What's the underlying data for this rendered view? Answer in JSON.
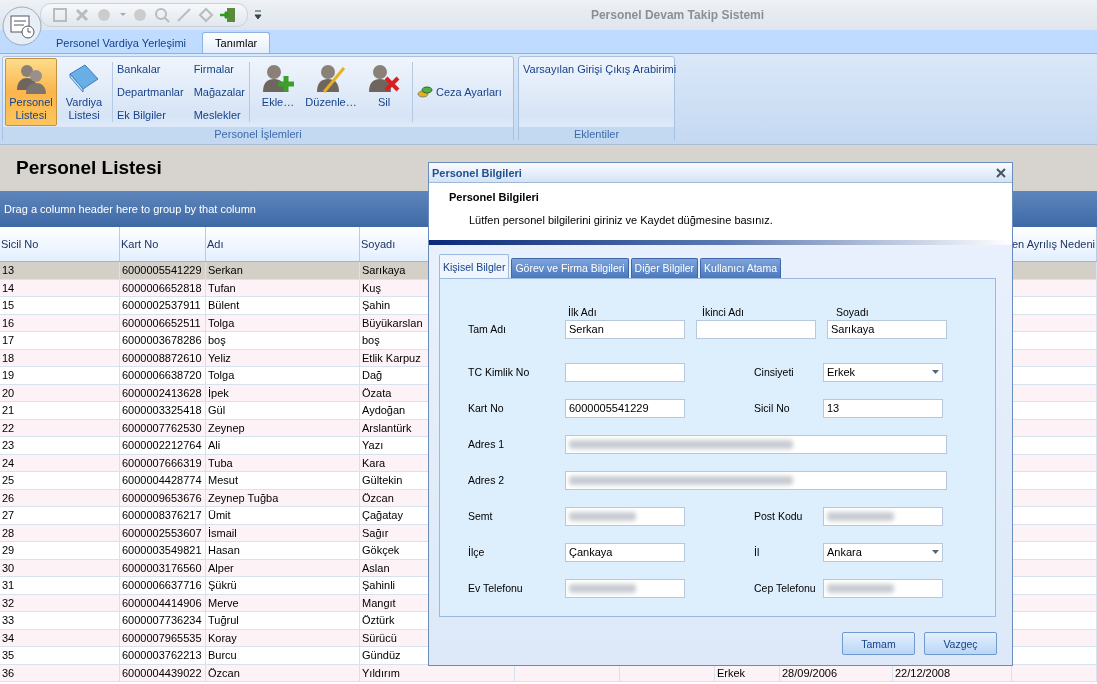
{
  "window": {
    "title": "Personel Devam Takip Sistemi"
  },
  "ribbon_tabs": [
    {
      "label": "Personel Vardiya Yerleşimi",
      "selected": false
    },
    {
      "label": "Tanımlar",
      "selected": true
    }
  ],
  "ribbon_groups": [
    {
      "caption": "Personel İşlemleri",
      "sections": [
        {
          "items": [
            {
              "kind": "large",
              "label": "Personel Listesi",
              "selected": true
            },
            {
              "kind": "large",
              "label": "Vardiya Listesi",
              "selected": false
            }
          ]
        },
        {
          "items": [
            {
              "kind": "link",
              "label": "Bankalar"
            },
            {
              "kind": "link",
              "label": "Departmanlar"
            },
            {
              "kind": "link",
              "label": "Ek Bilgiler"
            },
            {
              "kind": "link",
              "label": "Firmalar"
            },
            {
              "kind": "link",
              "label": "Mağazalar"
            },
            {
              "kind": "link",
              "label": "Meslekler"
            }
          ]
        },
        {
          "items": [
            {
              "kind": "large",
              "label": "Ekle…",
              "selected": false
            },
            {
              "kind": "large",
              "label": "Düzenle…",
              "selected": false
            },
            {
              "kind": "large",
              "label": "Sil",
              "selected": false
            }
          ]
        },
        {
          "items": [
            {
              "kind": "iconlink",
              "label": "Ceza Ayarları"
            }
          ]
        }
      ]
    },
    {
      "caption": "Eklentiler",
      "sections": [
        {
          "items": [
            {
              "kind": "link",
              "label": "Varsayılan Girişi Çıkış Arabirimi"
            }
          ]
        }
      ]
    }
  ],
  "page_title": "Personel Listesi",
  "group_panel": "Drag a column header here to group by that column",
  "table": {
    "columns": [
      "Sicil No",
      "Kart No",
      "Adı",
      "Soyadı"
    ],
    "last_column": "en Ayrılış Nedeni",
    "rows": [
      {
        "cells": [
          "13",
          "6000005541229",
          "Serkan",
          "Sarıkaya"
        ],
        "selected": true
      },
      {
        "cells": [
          "14",
          "6000006652818",
          "Tufan",
          "Kuş"
        ],
        "selected": false
      },
      {
        "cells": [
          "15",
          "6000002537911",
          "Bülent",
          "Şahin"
        ],
        "selected": false
      },
      {
        "cells": [
          "16",
          "6000006652511",
          "Tolga",
          "Büyükarslan"
        ],
        "selected": false
      },
      {
        "cells": [
          "17",
          "6000003678286",
          "boş",
          "boş"
        ],
        "selected": false
      },
      {
        "cells": [
          "18",
          "6000008872610",
          "Yeliz",
          "Etlik Karpuz"
        ],
        "selected": false
      },
      {
        "cells": [
          "19",
          "6000006638720",
          "Tolga",
          "Dağ"
        ],
        "selected": false
      },
      {
        "cells": [
          "20",
          "6000002413628",
          "İpek",
          "Özata"
        ],
        "selected": false
      },
      {
        "cells": [
          "21",
          "6000003325418",
          "Gül",
          "Aydoğan"
        ],
        "selected": false
      },
      {
        "cells": [
          "22",
          "6000007762530",
          "Zeynep",
          "Arslantürk"
        ],
        "selected": false
      },
      {
        "cells": [
          "23",
          "6000002212764",
          "Ali",
          "Yazı"
        ],
        "selected": false
      },
      {
        "cells": [
          "24",
          "6000007666319",
          "Tuba",
          "Kara"
        ],
        "selected": false
      },
      {
        "cells": [
          "25",
          "6000004428774",
          "Mesut",
          "Gültekin"
        ],
        "selected": false
      },
      {
        "cells": [
          "26",
          "6000009653676",
          "Zeynep Tuğba",
          "Özcan"
        ],
        "selected": false
      },
      {
        "cells": [
          "27",
          "6000008376217",
          "Ümit",
          "Çağatay"
        ],
        "selected": false
      },
      {
        "cells": [
          "28",
          "6000002553607",
          "İsmail",
          "Sağır"
        ],
        "selected": false
      },
      {
        "cells": [
          "29",
          "6000003549821",
          "Hasan",
          "Gökçek"
        ],
        "selected": false
      },
      {
        "cells": [
          "30",
          "6000003176560",
          "Alper",
          "Aslan"
        ],
        "selected": false
      },
      {
        "cells": [
          "31",
          "6000006637716",
          "Şükrü",
          "Şahinli"
        ],
        "selected": false
      },
      {
        "cells": [
          "32",
          "6000004414906",
          "Merve",
          "Mangıt"
        ],
        "selected": false
      },
      {
        "cells": [
          "33",
          "6000007736234",
          "Tuğrul",
          "Öztürk"
        ],
        "selected": false
      },
      {
        "cells": [
          "34",
          "6000007965535",
          "Koray",
          "Sürücü"
        ],
        "selected": false
      },
      {
        "cells": [
          "35",
          "6000003762213",
          "Burcu",
          "Gündüz"
        ],
        "selected": false
      },
      {
        "cells": [
          "36",
          "6000004439022",
          "Özcan",
          "Yıldırım"
        ],
        "cells_right": [
          "Erkek",
          "28/09/2006",
          "22/12/2008"
        ],
        "selected": false
      }
    ]
  },
  "dialog": {
    "title": "Personel Bilgileri",
    "heading": "Personel Bilgileri",
    "description": "Lütfen personel bilgilerini giriniz ve Kaydet düğmesine basınız.",
    "tabs": [
      {
        "label": "Kişisel Bilgler",
        "selected": true
      },
      {
        "label": "Görev ve Firma Bilgileri",
        "selected": false
      },
      {
        "label": "Diğer Bilgiler",
        "selected": false
      },
      {
        "label": "Kullanıcı Atama",
        "selected": false
      }
    ],
    "name_row": {
      "label": "Tam Adı",
      "fields": [
        {
          "caption": "İlk Adı",
          "value": "Serkan"
        },
        {
          "caption": "İkinci Adı"
        },
        {
          "caption": "Soyadı",
          "value": "Sarıkaya"
        }
      ]
    },
    "rows": [
      {
        "kind": "pair",
        "left": {
          "label": "TC Kimlik No",
          "kind": "text"
        },
        "right": {
          "label": "Cinsiyeti",
          "kind": "select",
          "value": "Erkek"
        }
      },
      {
        "kind": "pair",
        "left": {
          "label": "Kart No",
          "kind": "text",
          "value": "6000005541229"
        },
        "right": {
          "label": "Sicil No",
          "kind": "text",
          "value": "13"
        }
      },
      {
        "kind": "wide",
        "field": {
          "label": "Adres 1",
          "kind": "blurred"
        }
      },
      {
        "kind": "wide",
        "field": {
          "label": "Adres 2",
          "kind": "blurred"
        }
      },
      {
        "kind": "pair",
        "left": {
          "label": "Semt",
          "kind": "blurred"
        },
        "right": {
          "label": "Post Kodu",
          "kind": "blurred"
        }
      },
      {
        "kind": "pair",
        "left": {
          "label": "İlçe",
          "kind": "text",
          "value": "Çankaya"
        },
        "right": {
          "label": "İl",
          "kind": "select",
          "value": "Ankara"
        }
      },
      {
        "kind": "pair",
        "left": {
          "label": "Ev Telefonu",
          "kind": "blurred"
        },
        "right": {
          "label": "Cep Telefonu",
          "kind": "blurred"
        }
      }
    ],
    "buttons": [
      "Tamam",
      "Vazgeç"
    ]
  }
}
